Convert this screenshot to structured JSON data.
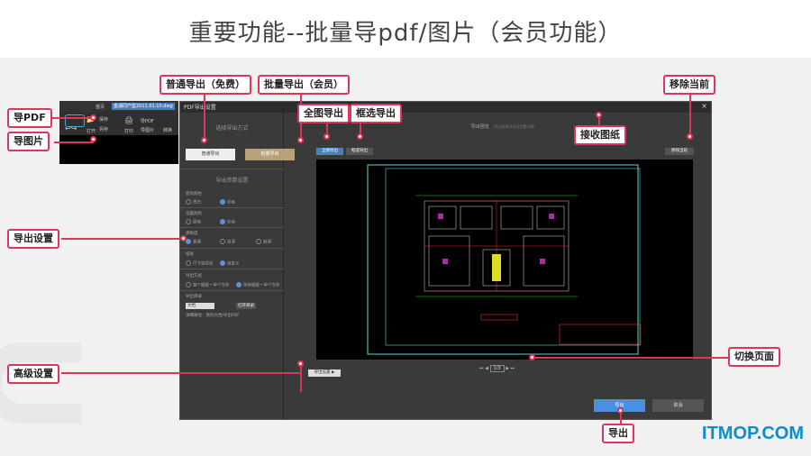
{
  "page": {
    "title": "重要功能--批量导pdf/图片（会员功能）"
  },
  "logo": "ITMOP.COM",
  "app": {
    "tab_home": "首页",
    "tab_file": "金湖同产型2011.01.10.dwg",
    "open": "打开",
    "save": "保存",
    "save_as": "另存",
    "print": "打印",
    "to_pdf": "导PDF",
    "to_image": "导图片",
    "convert": "转换"
  },
  "dialog": {
    "title": "PDF导出设置",
    "close": "×",
    "select_mode": "选择导出方式",
    "normal_export": "普通导出",
    "batch_export": "批量导出",
    "export_params": "导出参数设置",
    "bg_color_label": "底纹颜色",
    "bg_black": "黑白",
    "bg_color": "彩色",
    "layout_label": "设置颜色",
    "layout_orig": "原色",
    "layout_color": "彩色",
    "quality_label": "清晰度",
    "q_normal": "普通",
    "q_high": "高清",
    "q_super": "超清",
    "size_label": "纸张",
    "size_auto": "尺寸自适应",
    "size_custom": "自定义",
    "file_mode_label": "导出方式",
    "mode_each": "每个图纸一单个文件",
    "mode_all": "所有图纸一单个文件",
    "dir_label": "导出目录",
    "dir_select": "文档",
    "dir_open": "打开目录",
    "path_text": "详细路径：我的文档/导出PDF",
    "preview_title": "导出预览",
    "preview_hint": "（导出结果以导出设置为准）",
    "btn_full": "全图导出",
    "btn_frame": "框选导出",
    "btn_remove": "移除当前",
    "pager": "1/3",
    "advanced": "导出设置 ▶",
    "export": "导出",
    "cancel": "取消"
  },
  "callouts": {
    "normal_export": "普通导出（免费）",
    "batch_export": "批量导出（会员）",
    "full_export": "全图导出",
    "frame_export": "框选导出",
    "remove_current": "移除当前",
    "receive_drawing": "接收图纸",
    "to_pdf": "导PDF",
    "to_image": "导图片",
    "export_settings": "导出设置",
    "switch_page": "切换页面",
    "advanced": "高级设置",
    "export": "导出"
  }
}
